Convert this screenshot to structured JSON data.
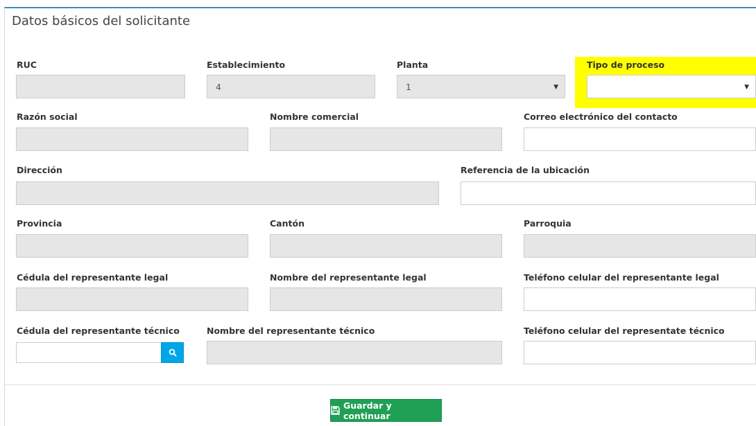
{
  "panel": {
    "title": "Datos básicos del solicitante"
  },
  "fields": {
    "ruc": {
      "label": "RUC",
      "value": ""
    },
    "establecimiento": {
      "label": "Establecimiento",
      "value": "4"
    },
    "planta": {
      "label": "Planta",
      "value": "1"
    },
    "tipo_proceso": {
      "label": "Tipo de proceso",
      "value": ""
    },
    "razon_social": {
      "label": "Razón social",
      "value": ""
    },
    "nombre_comercial": {
      "label": "Nombre comercial",
      "value": ""
    },
    "correo": {
      "label": "Correo electrónico del contacto",
      "value": ""
    },
    "direccion": {
      "label": "Dirección",
      "value": ""
    },
    "referencia": {
      "label": "Referencia de la ubicación",
      "value": ""
    },
    "provincia": {
      "label": "Provincia",
      "value": ""
    },
    "canton": {
      "label": "Cantón",
      "value": ""
    },
    "parroquia": {
      "label": "Parroquia",
      "value": ""
    },
    "cedula_legal": {
      "label": "Cédula del representante legal",
      "value": ""
    },
    "nombre_legal": {
      "label": "Nombre del representante legal",
      "value": ""
    },
    "telefono_legal": {
      "label": "Teléfono celular del representante legal",
      "value": ""
    },
    "cedula_tecnico": {
      "label": "Cédula del representante técnico",
      "value": ""
    },
    "nombre_tecnico": {
      "label": "Nombre del representante técnico",
      "value": ""
    },
    "telefono_tecnico": {
      "label": "Teléfono celular del representate técnico",
      "value": ""
    }
  },
  "actions": {
    "save_label": "Guardar y continuar"
  },
  "colors": {
    "accent": "#3c8dbc",
    "highlight": "#ffff00",
    "save": "#1fa055",
    "search": "#00a7e6"
  },
  "icons": {
    "save": "floppy-disk-icon",
    "search": "search-icon",
    "select": "caret-down-icon"
  }
}
